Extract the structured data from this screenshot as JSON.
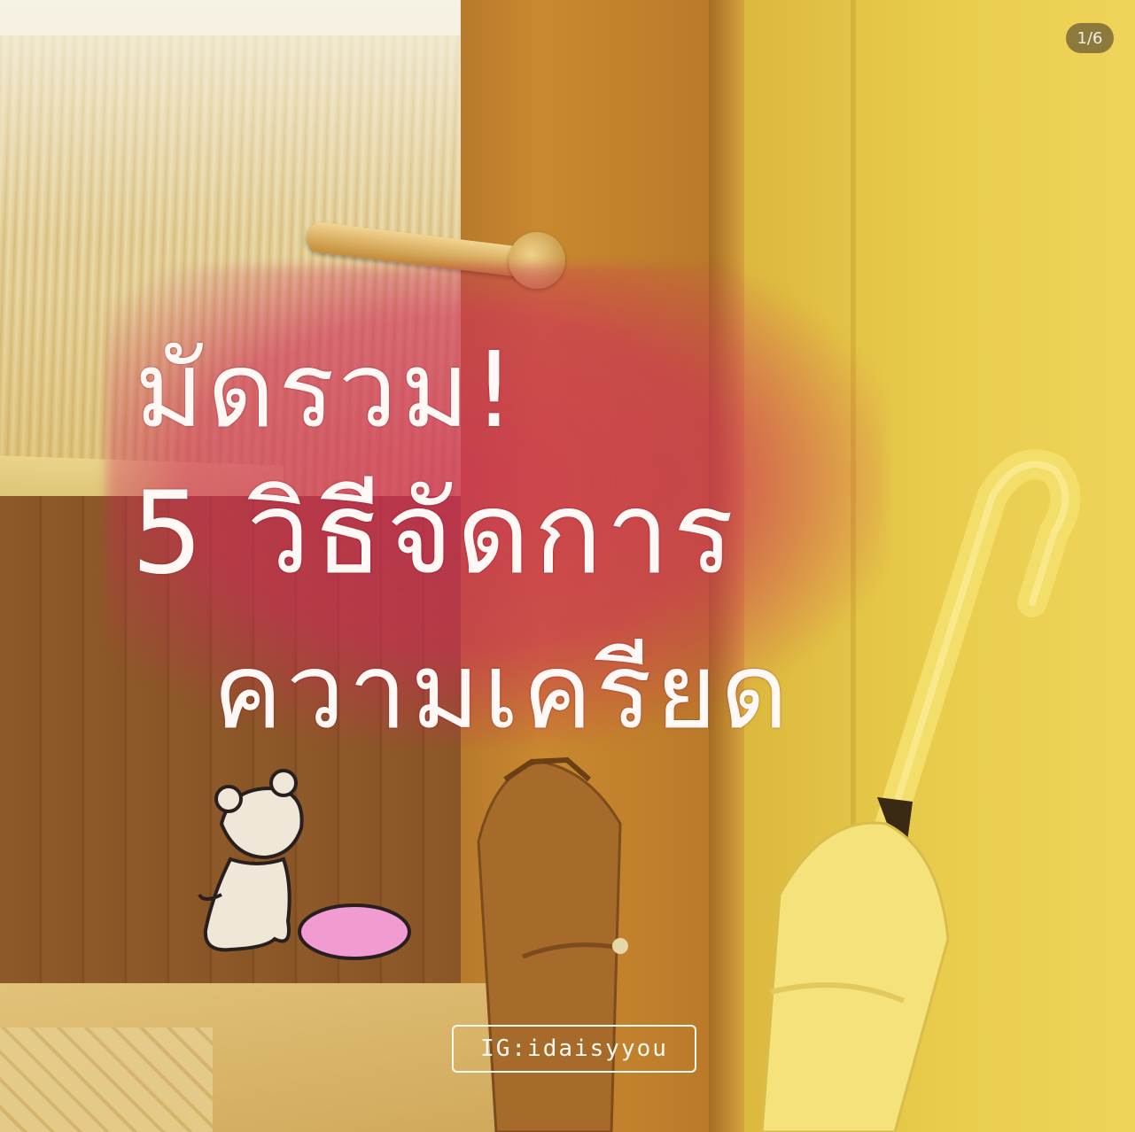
{
  "post": {
    "page_indicator": "1/6",
    "title_line_1": "มัดรวม!",
    "title_line_2": "5 วิธีจัดการ",
    "title_line_3": "ความเครียด",
    "ig_tag": "IG:idaisyyou"
  },
  "colors": {
    "highlight": "#cd285a",
    "text": "#fff8f4",
    "bear": "#efe7d8",
    "heart": "#f09cd3"
  },
  "icons": {
    "bear": "teddy-bear-sticker",
    "heart": "heart-sticker"
  }
}
